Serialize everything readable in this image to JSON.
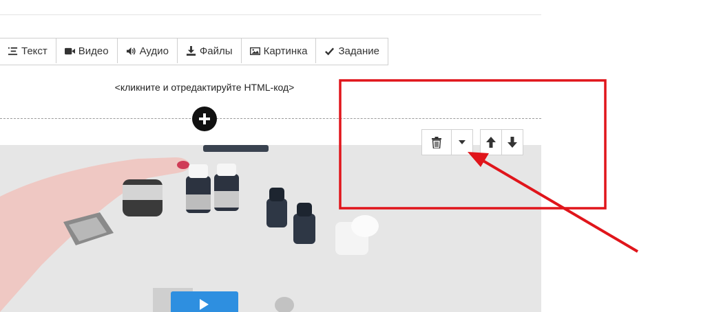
{
  "toolbar": {
    "items": [
      {
        "label": "Текст",
        "icon": "text-format-icon"
      },
      {
        "label": "Видео",
        "icon": "video-camera-icon"
      },
      {
        "label": "Аудио",
        "icon": "speaker-icon"
      },
      {
        "label": "Файлы",
        "icon": "download-icon"
      },
      {
        "label": "Картинка",
        "icon": "image-icon"
      },
      {
        "label": "Задание",
        "icon": "checkmark-icon"
      }
    ]
  },
  "editor": {
    "html_hint": "<кликните и отредактируйте HTML-код>"
  },
  "block_controls": {
    "delete_icon": "trash-icon",
    "dropdown_icon": "caret-down-icon",
    "move_up_icon": "arrow-up-icon",
    "move_down_icon": "arrow-down-icon"
  },
  "video_block": {
    "play_icon": "play-icon"
  },
  "annotation": {
    "highlight_color": "#e0151b"
  }
}
